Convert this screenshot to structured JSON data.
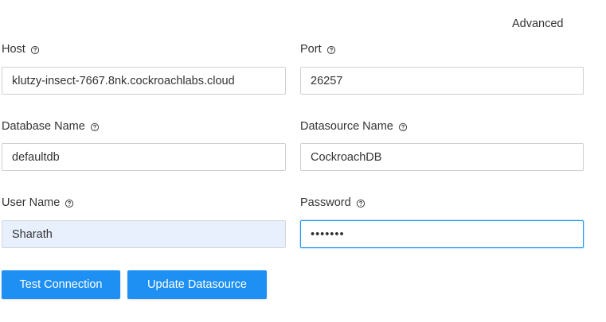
{
  "header": {
    "advanced_label": "Advanced"
  },
  "form": {
    "host": {
      "label": "Host",
      "value": "klutzy-insect-7667.8nk.cockroachlabs.cloud"
    },
    "port": {
      "label": "Port",
      "value": "26257"
    },
    "database_name": {
      "label": "Database Name",
      "value": "defaultdb"
    },
    "datasource_name": {
      "label": "Datasource Name",
      "value": "CockroachDB"
    },
    "user_name": {
      "label": "User Name",
      "value": "Sharath"
    },
    "password": {
      "label": "Password",
      "value": "•••••••"
    }
  },
  "actions": {
    "test_connection_label": "Test Connection",
    "update_datasource_label": "Update Datasource"
  },
  "icons": {
    "help": "help-circle-icon"
  },
  "colors": {
    "primary": "#1e90f4",
    "focus_border": "#2196f3",
    "autofill_bg": "#e8f0fe",
    "label_text": "#333333",
    "input_border": "#cfcfcf"
  }
}
